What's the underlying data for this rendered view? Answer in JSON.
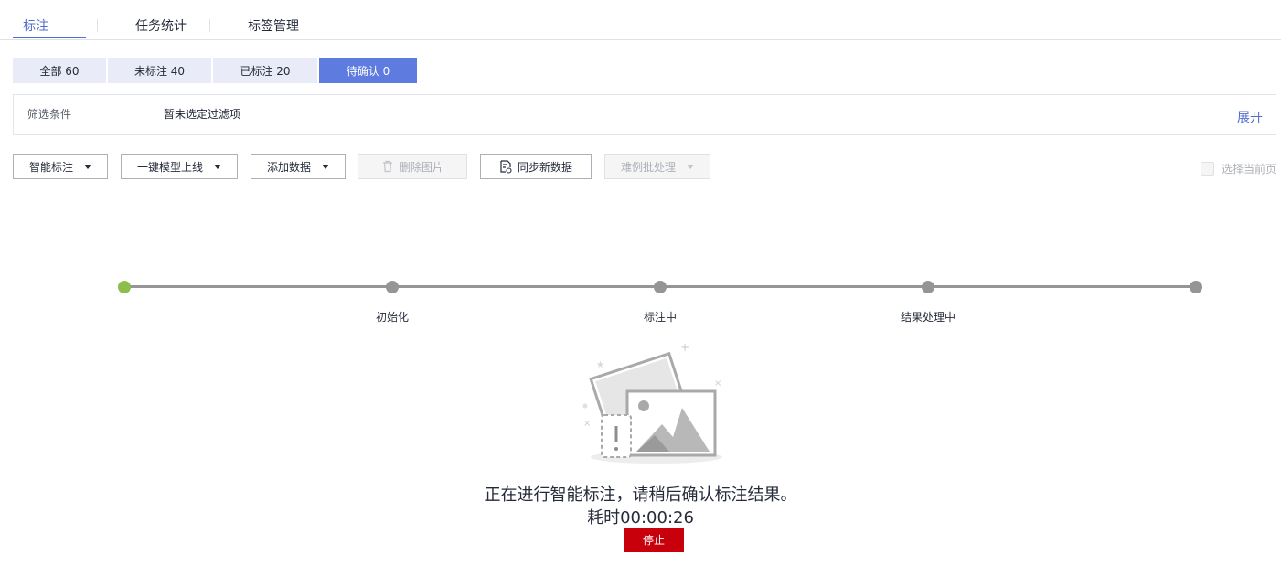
{
  "tabs": [
    {
      "label": "标注"
    },
    {
      "label": "任务统计"
    },
    {
      "label": "标签管理"
    }
  ],
  "status_filters": [
    {
      "label": "全部 60"
    },
    {
      "label": "未标注 40"
    },
    {
      "label": "已标注 20"
    },
    {
      "label": "待确认 0"
    }
  ],
  "filter": {
    "label": "筛选条件",
    "value": "暂未选定过滤项",
    "expand": "展开"
  },
  "toolbar": {
    "smart_label": "智能标注",
    "deploy_model": "一键模型上线",
    "add_data": "添加数据",
    "delete_images": "删除图片",
    "sync_data": "同步新数据",
    "hard_example": "难例批处理",
    "select_page": "选择当前页"
  },
  "steps": [
    {
      "label": ""
    },
    {
      "label": "初始化"
    },
    {
      "label": "标注中"
    },
    {
      "label": "结果处理中"
    },
    {
      "label": ""
    }
  ],
  "status": {
    "message": "正在进行智能标注，请稍后确认标注结果。",
    "elapsed": "耗时00:00:26",
    "stop": "停止"
  },
  "colors": {
    "accent": "#526ecc",
    "active_filter": "#5e7ce0",
    "step_done": "#8dbd4c",
    "danger": "#c7000b"
  }
}
